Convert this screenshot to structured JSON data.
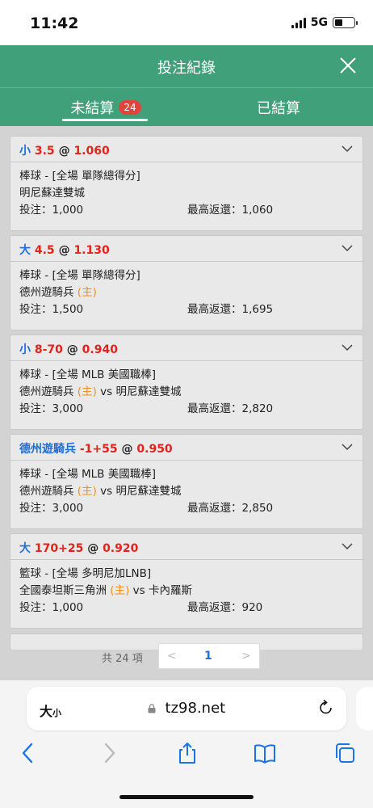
{
  "status_bar": {
    "time": "11:42",
    "network": "5G"
  },
  "header": {
    "title": "投注紀錄"
  },
  "tabs": {
    "unsettled_label": "未結算",
    "unsettled_count": "24",
    "settled_label": "已結算"
  },
  "bets": [
    {
      "selection": "小",
      "line": "3.5",
      "at": "@",
      "odds": "1.060",
      "market": "棒球 - [全場 單隊總得分]",
      "team1": "明尼蘇達雙城",
      "team1_tag": "",
      "vs": "",
      "team2": "",
      "stake": "投注：1,000",
      "max_return": "最高返還：1,060"
    },
    {
      "selection": "大",
      "line": "4.5",
      "at": "@",
      "odds": "1.130",
      "market": "棒球 - [全場 單隊總得分]",
      "team1": "德州遊騎兵",
      "team1_tag": "(主)",
      "vs": "",
      "team2": "",
      "stake": "投注：1,500",
      "max_return": "最高返還：1,695"
    },
    {
      "selection": "小",
      "line": "8-70",
      "at": "@",
      "odds": "0.940",
      "market": "棒球 - [全場 MLB 美國職棒]",
      "team1": "德州遊騎兵",
      "team1_tag": "(主)",
      "vs": "vs",
      "team2": "明尼蘇達雙城",
      "stake": "投注：3,000",
      "max_return": "最高返還：2,820"
    },
    {
      "selection": "德州遊騎兵",
      "line": "-1+55",
      "at": "@",
      "odds": "0.950",
      "market": "棒球 - [全場 MLB 美國職棒]",
      "team1": "德州遊騎兵",
      "team1_tag": "(主)",
      "vs": "vs",
      "team2": "明尼蘇達雙城",
      "stake": "投注：3,000",
      "max_return": "最高返還：2,850"
    },
    {
      "selection": "大",
      "line": "170+25",
      "at": "@",
      "odds": "0.920",
      "market": "籃球 - [全場 多明尼加LNB]",
      "team1": "全國泰坦斯三角洲",
      "team1_tag": "(主)",
      "vs": "vs",
      "team2": "卡內羅斯",
      "stake": "投注：1,000",
      "max_return": "最高返還：920"
    }
  ],
  "pager": {
    "total": "共 24 項",
    "prev": "<",
    "current": "1",
    "next": ">"
  },
  "browser": {
    "aa": "大",
    "aa_small": "小",
    "url": "tz98.net"
  },
  "icons": {
    "close": "close-icon",
    "expand": "chevron-down-icon",
    "lock": "lock-icon",
    "reload": "reload-icon",
    "back": "back-arrow-icon",
    "forward": "forward-arrow-icon",
    "share": "share-icon",
    "bookmarks": "book-icon",
    "tabs": "tabs-icon"
  },
  "colors": {
    "theme_green": "#3fa07a",
    "badge_red": "#e0453d",
    "selection_blue": "#1d6fd9",
    "odds_red": "#e0231b",
    "home_orange": "#f0901a",
    "ios_blue": "#1a73e8"
  }
}
